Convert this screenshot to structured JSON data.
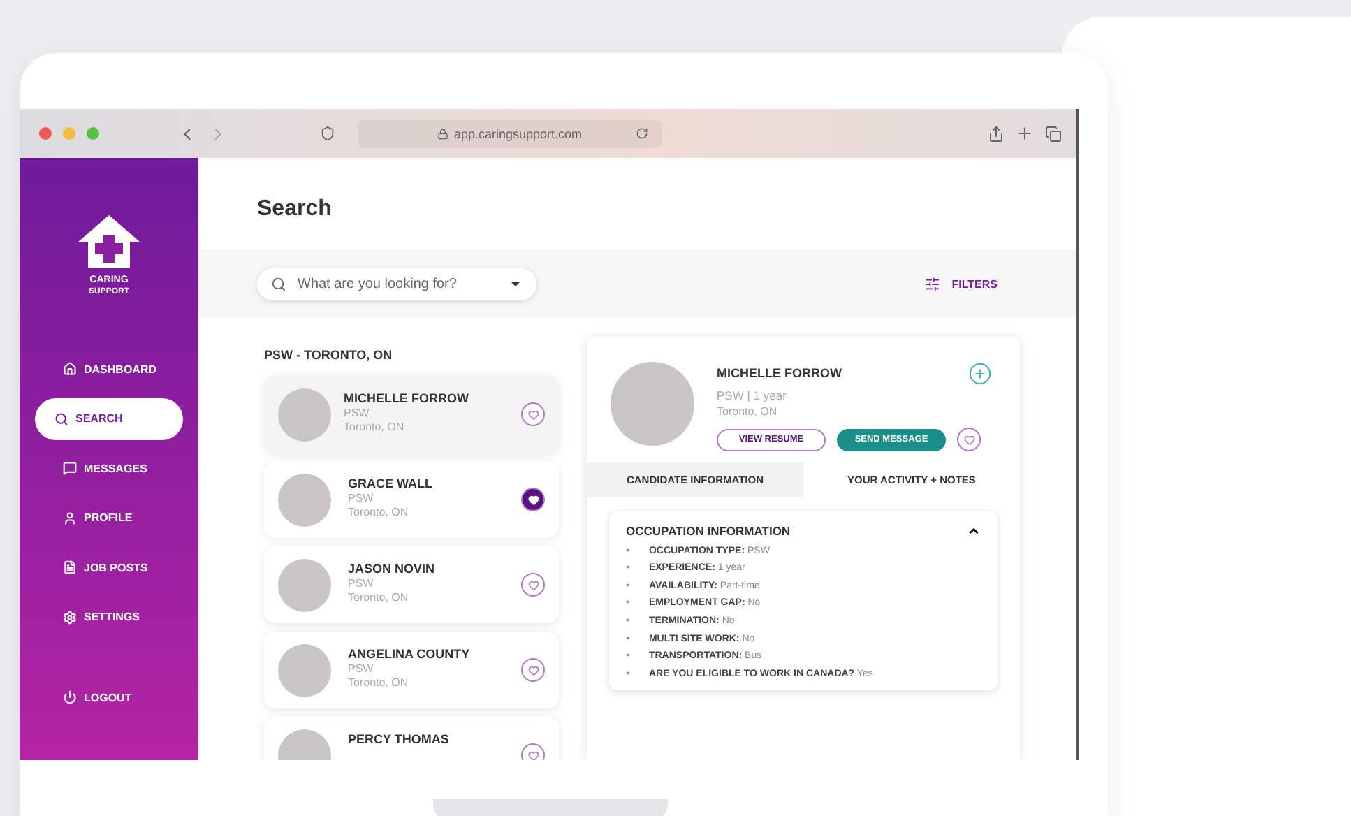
{
  "browser": {
    "url": "app.caringsupport.com"
  },
  "sidebar": {
    "brand": [
      "CARING",
      "SUPPORT"
    ],
    "items": [
      {
        "kind": "dashboard",
        "label": "DASHBOARD",
        "selected": false
      },
      {
        "kind": "search",
        "label": "SEARCH",
        "selected": true
      },
      {
        "kind": "messages",
        "label": "MESSAGES",
        "selected": false
      },
      {
        "kind": "profile",
        "label": "PROFILE",
        "selected": false
      },
      {
        "kind": "jobs",
        "label": "JOB POSTS",
        "selected": false
      },
      {
        "kind": "settings",
        "label": "SETTINGS",
        "selected": false
      }
    ],
    "logout": "LOGOUT"
  },
  "page_title": "Search",
  "search": {
    "placeholder": "What are you looking for?"
  },
  "filters": "FILTERS",
  "results_heading": "PSW - TORONTO, ON",
  "candidates": [
    {
      "name": "MICHELLE FORROW",
      "role": "PSW",
      "location": "Toronto, ON",
      "favorite": false,
      "selected": true
    },
    {
      "name": "GRACE WALL",
      "role": "PSW",
      "location": "Toronto, ON",
      "favorite": true,
      "selected": false
    },
    {
      "name": "JASON NOVIN",
      "role": "PSW",
      "location": "Toronto, ON",
      "favorite": false,
      "selected": false
    },
    {
      "name": "ANGELINA COUNTY",
      "role": "PSW",
      "location": "Toronto, ON",
      "favorite": false,
      "selected": false
    },
    {
      "name": "PERCY THOMAS",
      "favorite": false,
      "selected": false
    }
  ],
  "detail": {
    "name": "MICHELLE FORROW",
    "summary": "PSW | 1 year",
    "location": "Toronto, ON",
    "favorite": false,
    "buttons": [
      "VIEW RESUME",
      "SEND MESSAGE"
    ],
    "tabs": [
      {
        "label": "CANDIDATE INFORMATION",
        "selected": true
      },
      {
        "label": "YOUR ACTIVITY + NOTES",
        "selected": false
      }
    ],
    "section": {
      "title": "OCCUPATION INFORMATION",
      "expanded": true,
      "items": [
        {
          "bullet": "•",
          "text": "**OCCUPATION TYPE:** PSW"
        },
        {
          "bullet": "•",
          "text": "**EXPERIENCE:** 1 year"
        },
        {
          "bullet": "•",
          "text": "**AVAILABILITY:** Part-time"
        },
        {
          "bullet": "•",
          "text": "**EMPLOYMENT GAP:** No"
        },
        {
          "bullet": "•",
          "text": "**TERMINATION:** No"
        },
        {
          "bullet": "•",
          "text": "**MULTI SITE WORK:** No"
        },
        {
          "bullet": "•",
          "text": "**TRANSPORTATION:** Bus"
        },
        {
          "bullet": "•",
          "text": "**ARE YOU ELIGIBLE TO WORK IN CANADA?** Yes"
        }
      ]
    }
  }
}
